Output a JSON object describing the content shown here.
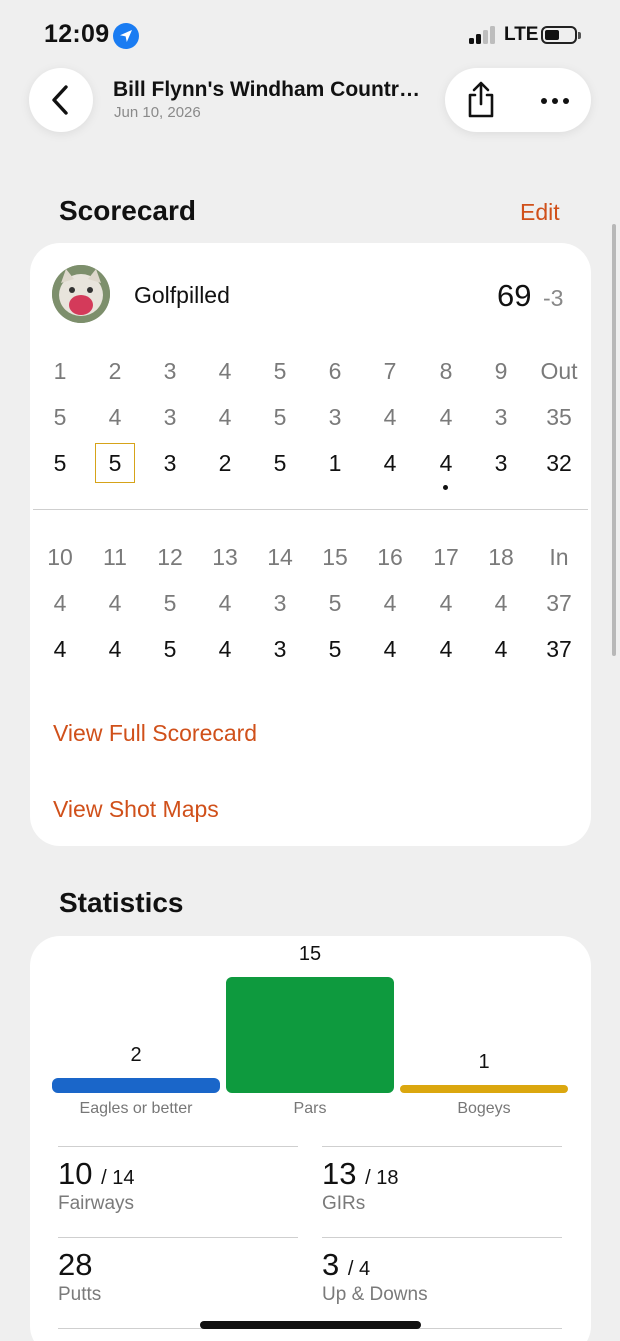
{
  "status_bar": {
    "time": "12:09",
    "network": "LTE",
    "location_icon": "location-arrow-icon",
    "battery_level": 0.45
  },
  "nav": {
    "title": "Bill Flynn's Windham Countr…",
    "date": "Jun 10, 2026",
    "back_icon": "chevron-left-icon",
    "share_icon": "share-icon",
    "more_icon": "ellipsis-icon"
  },
  "scorecard": {
    "section_title": "Scorecard",
    "edit_label": "Edit",
    "player": {
      "name": "Golfpilled",
      "total": "69",
      "to_par": "-3"
    },
    "front": {
      "holes": [
        "1",
        "2",
        "3",
        "4",
        "5",
        "6",
        "7",
        "8",
        "9",
        "Out"
      ],
      "par": [
        "5",
        "4",
        "3",
        "4",
        "5",
        "3",
        "4",
        "4",
        "3",
        "35"
      ],
      "score": [
        "5",
        "5",
        "3",
        "2",
        "5",
        "1",
        "4",
        "4",
        "3",
        "32"
      ]
    },
    "back": {
      "holes": [
        "10",
        "11",
        "12",
        "13",
        "14",
        "15",
        "16",
        "17",
        "18",
        "In"
      ],
      "par": [
        "4",
        "4",
        "5",
        "4",
        "3",
        "5",
        "4",
        "4",
        "4",
        "37"
      ],
      "score": [
        "4",
        "4",
        "5",
        "4",
        "3",
        "5",
        "4",
        "4",
        "4",
        "37"
      ]
    },
    "view_full_label": "View Full Scorecard",
    "view_shots_label": "View Shot Maps"
  },
  "statistics": {
    "section_title": "Statistics",
    "chart_data": {
      "type": "bar",
      "categories": [
        "Eagles or better",
        "Pars",
        "Bogeys"
      ],
      "values": [
        2,
        15,
        1
      ],
      "colors": [
        "#1a66c9",
        "#0e9a3e",
        "#dba70f"
      ]
    },
    "tiles": [
      {
        "value": "10",
        "total": "/ 14",
        "label": "Fairways"
      },
      {
        "value": "13",
        "total": "/ 18",
        "label": "GIRs"
      },
      {
        "value": "28",
        "total": "",
        "label": "Putts"
      },
      {
        "value": "3",
        "total": "/ 4",
        "label": "Up & Downs"
      }
    ]
  },
  "colors": {
    "accent": "#d0501a",
    "background": "#efefef",
    "card": "#ffffff"
  }
}
